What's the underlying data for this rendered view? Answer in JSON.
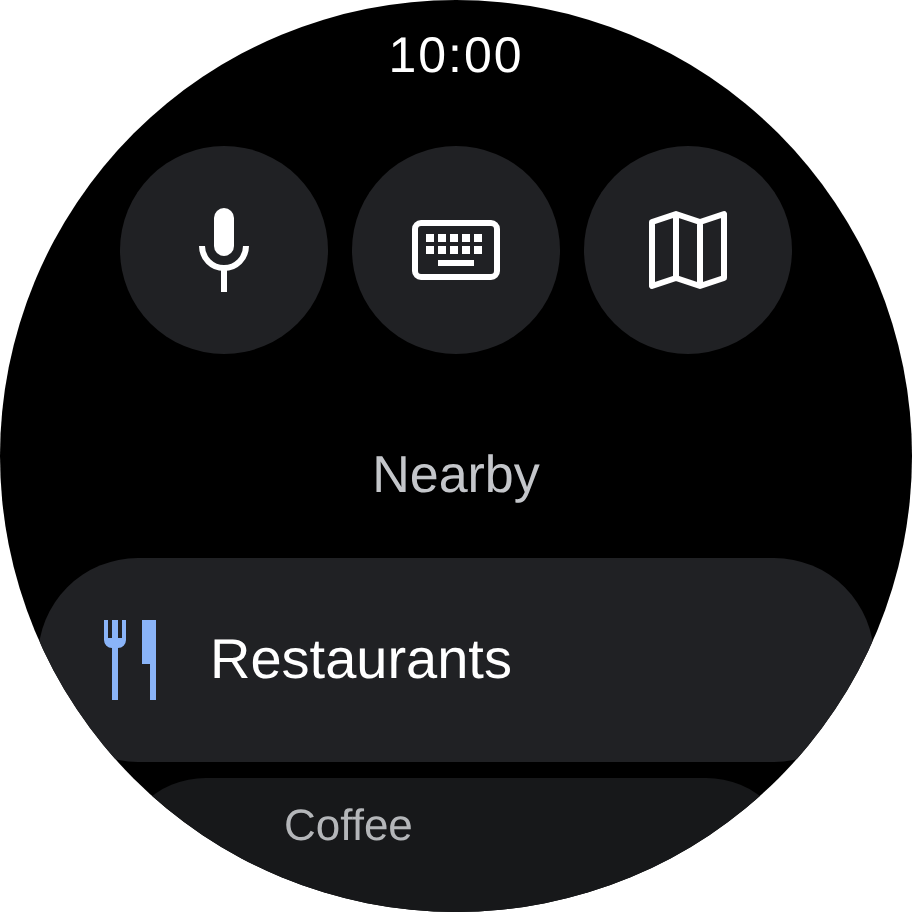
{
  "status": {
    "time": "10:00"
  },
  "section_title": "Nearby",
  "chips": [
    {
      "label": "Restaurants",
      "kind": "primary"
    },
    {
      "label": "Coffee",
      "kind": "secondary"
    }
  ]
}
